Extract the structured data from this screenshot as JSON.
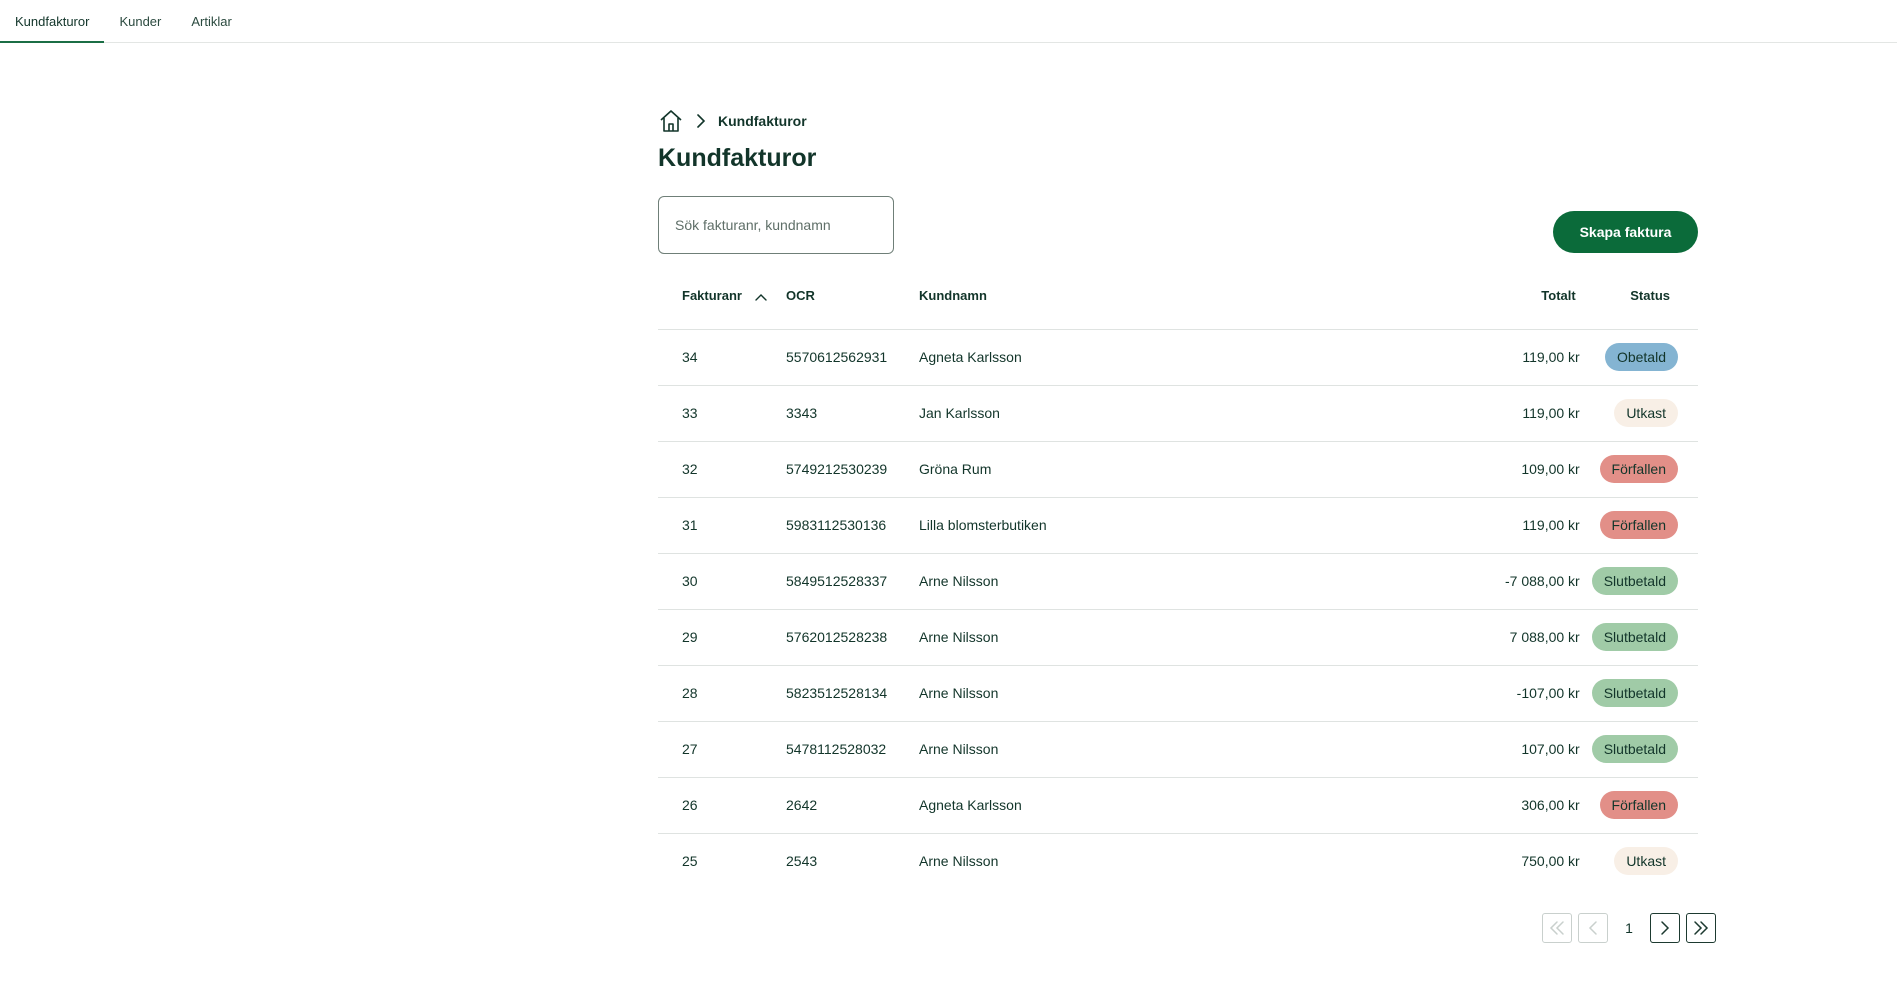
{
  "nav": {
    "tabs": [
      {
        "label": "Kundfakturor",
        "active": true
      },
      {
        "label": "Kunder",
        "active": false
      },
      {
        "label": "Artiklar",
        "active": false
      }
    ]
  },
  "breadcrumb": {
    "home_icon": "home-icon",
    "separator_icon": "chevron-right-icon",
    "current": "Kundfakturor"
  },
  "page": {
    "title": "Kundfakturor"
  },
  "search": {
    "placeholder": "Sök fakturanr, kundnamn",
    "value": ""
  },
  "actions": {
    "create_label": "Skapa faktura"
  },
  "table": {
    "columns": {
      "invoice_no": "Fakturanr",
      "ocr": "OCR",
      "customer": "Kundnamn",
      "total": "Totalt",
      "status": "Status"
    },
    "sort": {
      "column": "Fakturanr",
      "direction": "ascending-indicator"
    },
    "rows": [
      {
        "invoice_no": "34",
        "ocr": "5570612562931",
        "customer": "Agneta Karlsson",
        "total": "119,00 kr",
        "status": "Obetald",
        "status_color": "#84b4d2"
      },
      {
        "invoice_no": "33",
        "ocr": "3343",
        "customer": "Jan Karlsson",
        "total": "119,00 kr",
        "status": "Utkast",
        "status_color": "#f8efe6"
      },
      {
        "invoice_no": "32",
        "ocr": "5749212530239",
        "customer": "Gröna Rum",
        "total": "109,00 kr",
        "status": "Förfallen",
        "status_color": "#e28f88"
      },
      {
        "invoice_no": "31",
        "ocr": "5983112530136",
        "customer": "Lilla blomsterbutiken",
        "total": "119,00 kr",
        "status": "Förfallen",
        "status_color": "#e28f88"
      },
      {
        "invoice_no": "30",
        "ocr": "5849512528337",
        "customer": "Arne Nilsson",
        "total": "-7 088,00 kr",
        "status": "Slutbetald",
        "status_color": "#a0cba7"
      },
      {
        "invoice_no": "29",
        "ocr": "5762012528238",
        "customer": "Arne Nilsson",
        "total": "7 088,00 kr",
        "status": "Slutbetald",
        "status_color": "#a0cba7"
      },
      {
        "invoice_no": "28",
        "ocr": "5823512528134",
        "customer": "Arne Nilsson",
        "total": "-107,00 kr",
        "status": "Slutbetald",
        "status_color": "#a0cba7"
      },
      {
        "invoice_no": "27",
        "ocr": "5478112528032",
        "customer": "Arne Nilsson",
        "total": "107,00 kr",
        "status": "Slutbetald",
        "status_color": "#a0cba7"
      },
      {
        "invoice_no": "26",
        "ocr": "2642",
        "customer": "Agneta Karlsson",
        "total": "306,00 kr",
        "status": "Förfallen",
        "status_color": "#e28f88"
      },
      {
        "invoice_no": "25",
        "ocr": "2543",
        "customer": "Arne Nilsson",
        "total": "750,00 kr",
        "status": "Utkast",
        "status_color": "#f8efe6"
      }
    ]
  },
  "pagination": {
    "current_page": "1",
    "first_icon": "double-chevron-left-icon",
    "prev_icon": "chevron-left-icon",
    "next_icon": "chevron-right-icon",
    "last_icon": "double-chevron-right-icon",
    "first_enabled": false,
    "prev_enabled": false,
    "next_enabled": true,
    "last_enabled": true
  },
  "colors": {
    "brand": "#0b6b3a",
    "text": "#12352a",
    "status_obetald": "#84b4d2",
    "status_utkast": "#f8efe6",
    "status_forfallen": "#e28f88",
    "status_slutbetald": "#a0cba7"
  }
}
